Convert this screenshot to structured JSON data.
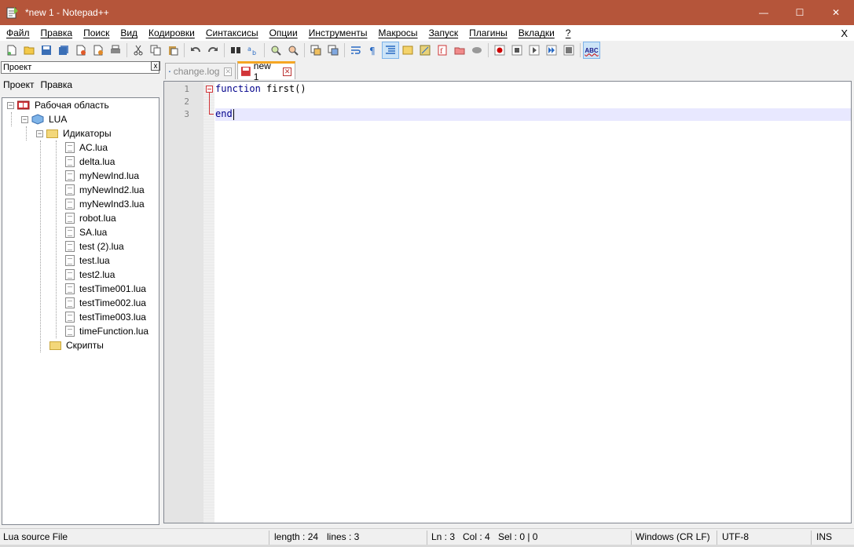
{
  "window": {
    "title": "*new 1 - Notepad++",
    "minimize": "—",
    "maximize": "☐",
    "close": "✕"
  },
  "menu": {
    "items": [
      "Файл",
      "Правка",
      "Поиск",
      "Вид",
      "Кодировки",
      "Синтаксисы",
      "Опции",
      "Инструменты",
      "Макросы",
      "Запуск",
      "Плагины",
      "Вкладки",
      "?"
    ],
    "close_doc": "X"
  },
  "toolbar": {
    "icons": [
      "new-file-icon",
      "open-file-icon",
      "save-icon",
      "save-all-icon",
      "close-icon",
      "close-all-icon",
      "print-icon",
      "cut-icon",
      "copy-icon",
      "paste-icon",
      "undo-icon",
      "redo-icon",
      "find-icon",
      "replace-icon",
      "zoom-in-icon",
      "zoom-out-icon",
      "sync-v-icon",
      "sync-h-icon",
      "word-wrap-icon",
      "show-all-chars-icon",
      "indent-guide-icon",
      "doc-map-icon",
      "function-list-icon",
      "folder-workspace-icon",
      "monitor-icon",
      "record-macro-icon",
      "stop-macro-icon",
      "play-macro-icon",
      "run-macro-multiple-icon",
      "save-macro-icon",
      "spell-check-icon"
    ],
    "spell_label": "ABC"
  },
  "panel": {
    "title": "Проект",
    "close": "x",
    "menu": [
      "Проект",
      "Правка"
    ],
    "workspace": "Рабочая область",
    "project": "LUA",
    "folder1": "Идикаторы",
    "files": [
      "AC.lua",
      "delta.lua",
      "myNewInd.lua",
      "myNewInd2.lua",
      "myNewInd3.lua",
      "robot.lua",
      "SA.lua",
      "test (2).lua",
      "test.lua",
      "test2.lua",
      "testTime001.lua",
      "testTime002.lua",
      "testTime003.lua",
      "timeFunction.lua"
    ],
    "folder2": "Скрипты"
  },
  "tabs": [
    {
      "label": "change.log",
      "active": false
    },
    {
      "label": "new 1",
      "active": true
    }
  ],
  "editor": {
    "lines": [
      {
        "no": "1",
        "kw": "function",
        "rest": " first()"
      },
      {
        "no": "2",
        "kw": "",
        "rest": ""
      },
      {
        "no": "3",
        "kw": "end",
        "rest": ""
      }
    ]
  },
  "status": {
    "type": "Lua source File",
    "length": "length : 24",
    "lines": "lines : 3",
    "ln": "Ln : 3",
    "col": "Col : 4",
    "sel": "Sel : 0 | 0",
    "eol": "Windows (CR LF)",
    "encoding": "UTF-8",
    "mode": "INS"
  }
}
